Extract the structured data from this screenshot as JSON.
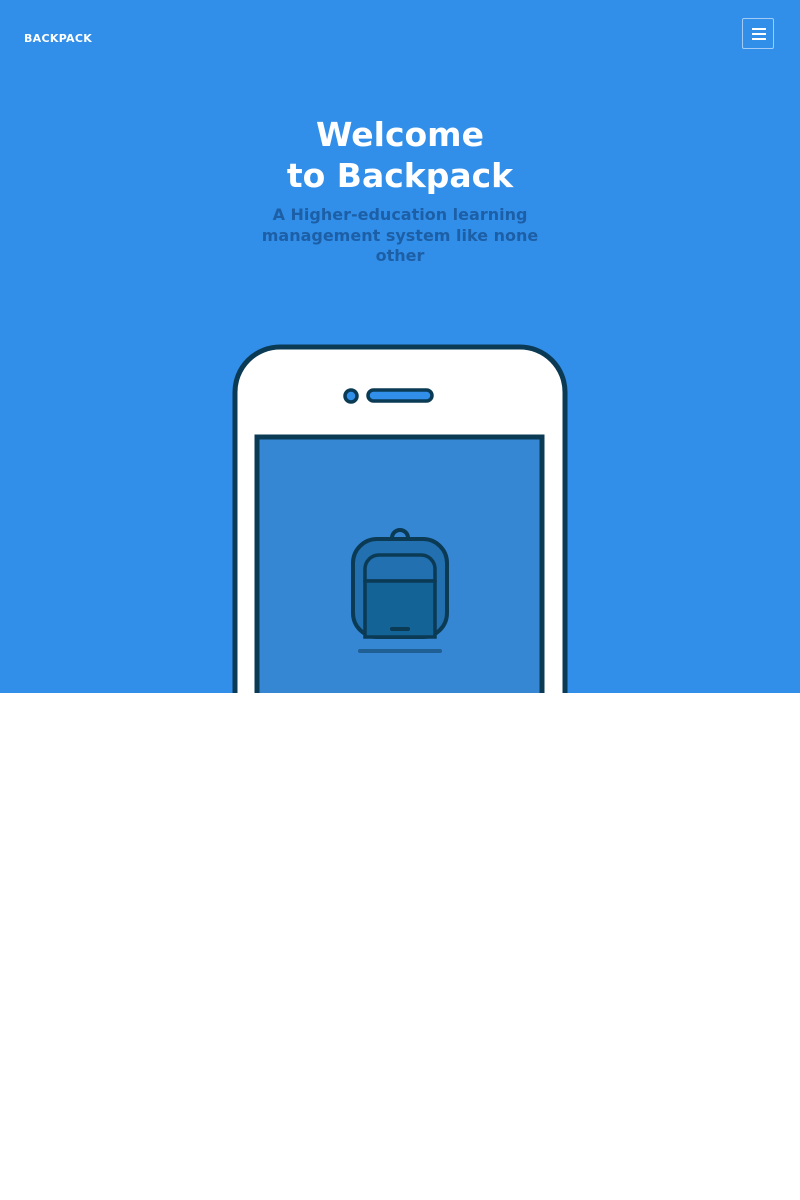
{
  "header": {
    "brand": "BACKPACK",
    "menu_icon": "hamburger-menu-icon"
  },
  "hero": {
    "title_line1": "Welcome",
    "title_line2": "to Backpack",
    "subtitle": "A Higher-education learning management system like none other"
  },
  "illustration": {
    "device_icon": "smartphone-icon",
    "screen_icon": "backpack-icon"
  },
  "colors": {
    "hero_background": "#318fea",
    "subtitle": "#1d5fa6",
    "outline": "#0b3a55",
    "screen": "#3587d4",
    "backpack_fill": "#2270b0",
    "backpack_pocket": "#146396"
  }
}
